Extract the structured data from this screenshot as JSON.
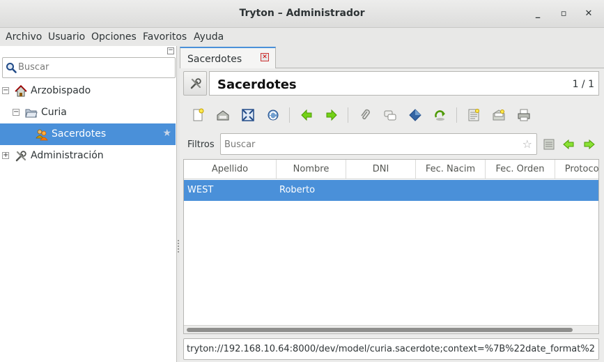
{
  "window": {
    "title": "Tryton – Administrador",
    "minimize": "_",
    "maximize": "▫",
    "close": "✕"
  },
  "menubar": {
    "items": [
      "Archivo",
      "Usuario",
      "Opciones",
      "Favoritos",
      "Ayuda"
    ]
  },
  "sidebar": {
    "search_placeholder": "Buscar",
    "tree": [
      {
        "label": "Arzobispado",
        "expander": "−",
        "icon": "home-icon"
      },
      {
        "label": "Curia",
        "expander": "−",
        "icon": "folder-open-icon"
      },
      {
        "label": "Sacerdotes",
        "expander": "",
        "icon": "people-icon",
        "selected": true
      },
      {
        "label": "Administración",
        "expander": "+",
        "icon": "tools-icon"
      }
    ]
  },
  "tabs": [
    {
      "label": "Sacerdotes",
      "close": "✕"
    }
  ],
  "form": {
    "title": "Sacerdotes",
    "record_count": "1 / 1"
  },
  "toolbar": {
    "buttons": [
      "new-icon",
      "save-icon",
      "switch-view-icon",
      "reload-icon",
      "previous-icon",
      "next-icon",
      "attachment-icon",
      "notes-icon",
      "action-icon",
      "relate-icon",
      "report-icon",
      "email-icon",
      "print-icon"
    ]
  },
  "filters": {
    "label": "Filtros",
    "placeholder": "Buscar",
    "star": "☆"
  },
  "table": {
    "columns": [
      "Apellido",
      "Nombre",
      "DNI",
      "Fec. Nacim",
      "Fec. Orden",
      "Protocol"
    ],
    "rows": [
      {
        "apellido": "WEST",
        "nombre": "Roberto",
        "dni": "",
        "fec_nacim": "",
        "fec_orden": "",
        "protocol": ""
      }
    ]
  },
  "url": "tryton://192.168.10.64:8000/dev/model/curia.sacerdote;context=%7B%22date_format%2",
  "colors": {
    "selection": "#4a90d9",
    "tab_accent": "#4a90d9",
    "green_arrow": "#4e9a06"
  }
}
